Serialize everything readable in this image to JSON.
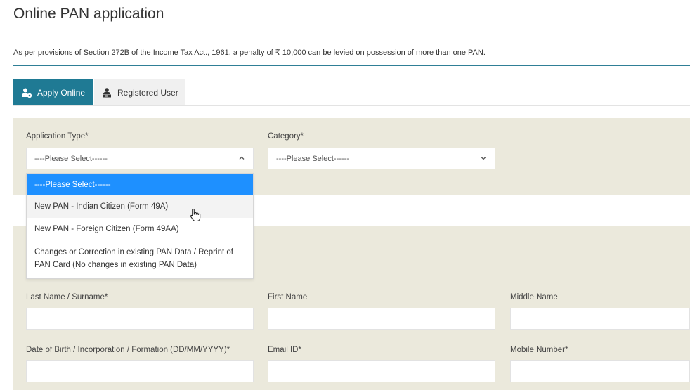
{
  "page": {
    "title": "Online PAN application",
    "notice": "As per provisions of Section 272B of the Income Tax Act., 1961, a penalty of ₹ 10,000 can be levied on possession of more than one PAN."
  },
  "tabs": [
    {
      "label": "Apply Online",
      "icon": "user-apply-icon",
      "active": true
    },
    {
      "label": "Registered User",
      "icon": "registered-user-icon",
      "active": false
    }
  ],
  "form": {
    "application_type": {
      "label": "Application Type*",
      "value": "----Please Select------"
    },
    "category": {
      "label": "Category*",
      "value": "----Please Select------"
    },
    "application_type_options": [
      "----Please Select------",
      "New PAN - Indian Citizen (Form 49A)",
      "New PAN - Foreign Citizen (Form 49AA)",
      "Changes or Correction in existing PAN Data / Reprint of PAN Card (No changes in existing PAN Data)"
    ],
    "last_name": {
      "label": "Last Name / Surname*",
      "value": ""
    },
    "first_name": {
      "label": "First Name",
      "value": ""
    },
    "middle_name": {
      "label": "Middle Name",
      "value": ""
    },
    "dob": {
      "label": "Date of Birth / Incorporation / Formation (DD/MM/YYYY)*",
      "value": ""
    },
    "email": {
      "label": "Email ID*",
      "value": ""
    },
    "mobile": {
      "label": "Mobile Number*",
      "value": ""
    }
  },
  "colors": {
    "accent": "#1f7a94",
    "panel": "#ebe9dc",
    "selected_option": "#1e90ff"
  }
}
